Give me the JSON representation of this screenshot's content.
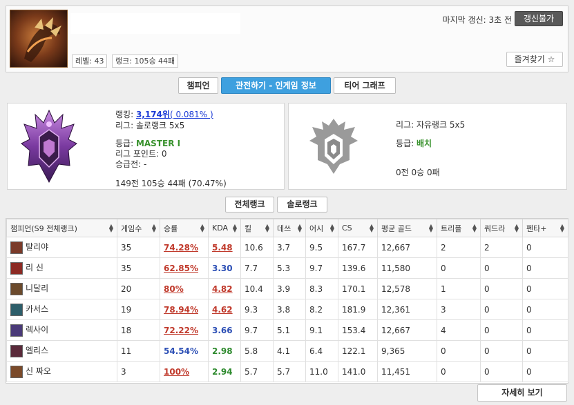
{
  "header": {
    "level_label": "레벨: 43",
    "rank_label": "랭크: 105승 44패",
    "last_update": "마지막 갱신: 3초 전",
    "refresh_disabled": "갱신불가",
    "favorite": "즐겨찾기 ☆"
  },
  "tabs": [
    {
      "label": "챔피언",
      "active": false
    },
    {
      "label": "관전하기 - 인게임 정보",
      "active": true
    },
    {
      "label": "티어 그래프",
      "active": false
    }
  ],
  "solo": {
    "ranking_prefix": "랭킹:",
    "ranking_value": "3,174위",
    "ranking_pct": "( 0.081% )",
    "league": "리그: 솔로랭크 5x5",
    "tier_prefix": "등급:",
    "tier_value": "MASTER I",
    "lp": "리그 포인트: 0",
    "promo": "승급전: -",
    "record": "149전 105승 44패 (70.47%)"
  },
  "flex": {
    "league": "리그: 자유랭크 5x5",
    "tier_prefix": "등급:",
    "tier_value": "배치",
    "record": "0전 0승 0패"
  },
  "filters": [
    "전체랭크",
    "솔로랭크"
  ],
  "table": {
    "headers": [
      "챔피언(S9 전체랭크)",
      "게임수",
      "승률",
      "KDA",
      "킬",
      "데쓰",
      "어시",
      "CS",
      "평균 골드",
      "트리플",
      "쿼드라",
      "펜타+"
    ],
    "rows": [
      {
        "champ": "탈리야",
        "games": "35",
        "wr": "74.28%",
        "wr_style": "red",
        "kda": "5.48",
        "kda_style": "red",
        "k": "10.6",
        "d": "3.7",
        "a": "9.5",
        "cs": "167.7",
        "gold": "12,667",
        "t": "2",
        "q": "2",
        "p": "0",
        "icon": "#7a3b2a"
      },
      {
        "champ": "리 신",
        "games": "35",
        "wr": "62.85%",
        "wr_style": "red",
        "kda": "3.30",
        "kda_style": "blue",
        "k": "7.7",
        "d": "5.3",
        "a": "9.7",
        "cs": "139.6",
        "gold": "11,580",
        "t": "0",
        "q": "0",
        "p": "0",
        "icon": "#8c2a24"
      },
      {
        "champ": "니달리",
        "games": "20",
        "wr": "80%",
        "wr_style": "red",
        "kda": "4.82",
        "kda_style": "red",
        "k": "10.4",
        "d": "3.9",
        "a": "8.3",
        "cs": "170.1",
        "gold": "12,578",
        "t": "1",
        "q": "0",
        "p": "0",
        "icon": "#6b4a2c"
      },
      {
        "champ": "카서스",
        "games": "19",
        "wr": "78.94%",
        "wr_style": "red",
        "kda": "4.62",
        "kda_style": "red",
        "k": "9.3",
        "d": "3.8",
        "a": "8.2",
        "cs": "181.9",
        "gold": "12,361",
        "t": "3",
        "q": "0",
        "p": "0",
        "icon": "#2d5e6a"
      },
      {
        "champ": "렉사이",
        "games": "18",
        "wr": "72.22%",
        "wr_style": "red",
        "kda": "3.66",
        "kda_style": "blue",
        "k": "9.7",
        "d": "5.1",
        "a": "9.1",
        "cs": "153.4",
        "gold": "12,667",
        "t": "4",
        "q": "0",
        "p": "0",
        "icon": "#4a3a78"
      },
      {
        "champ": "엘리스",
        "games": "11",
        "wr": "54.54%",
        "wr_style": "blue",
        "kda": "2.98",
        "kda_style": "green",
        "k": "5.8",
        "d": "4.1",
        "a": "6.4",
        "cs": "122.1",
        "gold": "9,365",
        "t": "0",
        "q": "0",
        "p": "0",
        "icon": "#5a2a3a"
      },
      {
        "champ": "신 짜오",
        "games": "3",
        "wr": "100%",
        "wr_style": "red",
        "kda": "2.94",
        "kda_style": "green",
        "k": "5.7",
        "d": "5.7",
        "a": "11.0",
        "cs": "141.0",
        "gold": "11,451",
        "t": "0",
        "q": "0",
        "p": "0",
        "icon": "#7a4a2a"
      }
    ]
  },
  "more_button": "자세히 보기",
  "colors": {
    "accent": "#3ea0df",
    "win_red": "#c0392b",
    "kda_blue": "#2c4fb5",
    "kda_green": "#2e8a2e",
    "tier_green": "#39922d"
  }
}
